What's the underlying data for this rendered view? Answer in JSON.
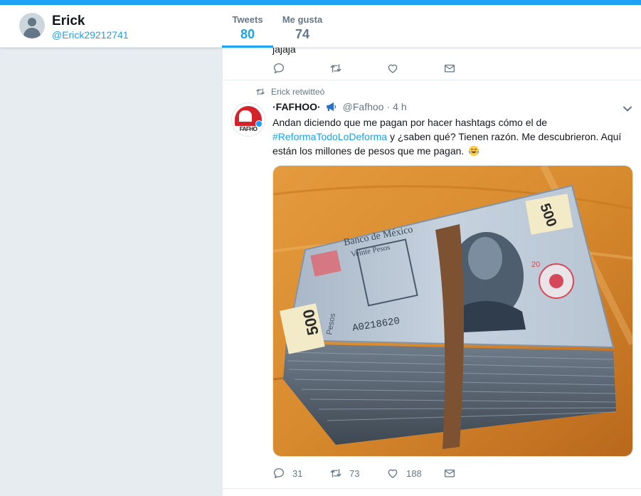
{
  "profile": {
    "name": "Erick",
    "handle": "@Erick29212741"
  },
  "stats": {
    "tweets_label": "Tweets",
    "tweets_value": "80",
    "likes_label": "Me gusta",
    "likes_value": "74"
  },
  "previous_tweet": {
    "text_fragment": "jajaja"
  },
  "tweet": {
    "retweet_context": "Erick retwitteó",
    "author_name": "·FAFHOO·",
    "author_handle": "@Fafhoo",
    "separator": "·",
    "time": "4 h",
    "text_part1": "Andan diciendo que me pagan por hacer hashtags cómo el de",
    "hashtag": "#ReformaTodoLoDeforma",
    "text_part2": "  y ¿saben qué? Tienen razón. Me descubrieron. Aquí están los millones de pesos que me pagan.",
    "avatar_logo_text": "FAFHO",
    "image_texts": {
      "bank": "Banco de México",
      "denomination_name": "Veinte Pesos",
      "value": "500",
      "serial": "A0218620",
      "currency": "Pesos",
      "corner_number": "20"
    },
    "counts": {
      "replies": "31",
      "retweets": "73",
      "likes": "188"
    }
  },
  "icons": {
    "reply": "reply-icon",
    "retweet": "retweet-icon",
    "like": "heart-icon",
    "dm": "envelope-icon",
    "caret": "chevron-down-icon",
    "megaphone": "megaphone-icon",
    "emoji": "tears-of-joy-emoji"
  },
  "colors": {
    "accent": "#1da1f2",
    "text": "#14171a",
    "muted": "#657786",
    "background": "#e6ecf0"
  }
}
